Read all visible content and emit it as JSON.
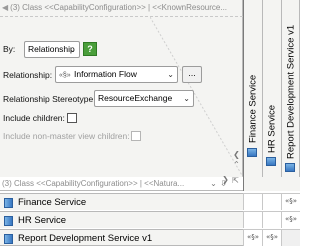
{
  "header": {
    "class_title_top": "(3) Class <<CapabilityConfiguration>> | <<KnownResource...",
    "class_title_bottom": "(3) Class <<CapabilityConfiguration>> | <<Natura..."
  },
  "settings": {
    "by_label": "By:",
    "by_value": "Relationship",
    "help_label": "?",
    "relationship_label": "Relationship:",
    "relationship_icon": "«§»",
    "relationship_value": "Information Flow",
    "browse_label": "...",
    "stereotype_label": "Relationship Stereotype:",
    "stereotype_value": "ResourceExchange",
    "include_children_label": "Include children:",
    "include_nonmaster_label": "Include non-master view children:",
    "include_children_checked": false,
    "include_nonmaster_checked": false
  },
  "columns": [
    {
      "label": "Finance Service"
    },
    {
      "label": "HR Service"
    },
    {
      "label": "Report Development Service v1"
    }
  ],
  "rows": [
    {
      "label": "Finance Service",
      "cells": [
        "",
        "",
        "«§»"
      ]
    },
    {
      "label": "HR Service",
      "cells": [
        "",
        "",
        "«§»"
      ]
    },
    {
      "label": "Report Development Service v1",
      "cells": [
        "«§»",
        "«§»",
        ""
      ]
    }
  ],
  "icons": {
    "element_icon": "service-element-icon",
    "relationship_marker": "information-flow-icon"
  }
}
